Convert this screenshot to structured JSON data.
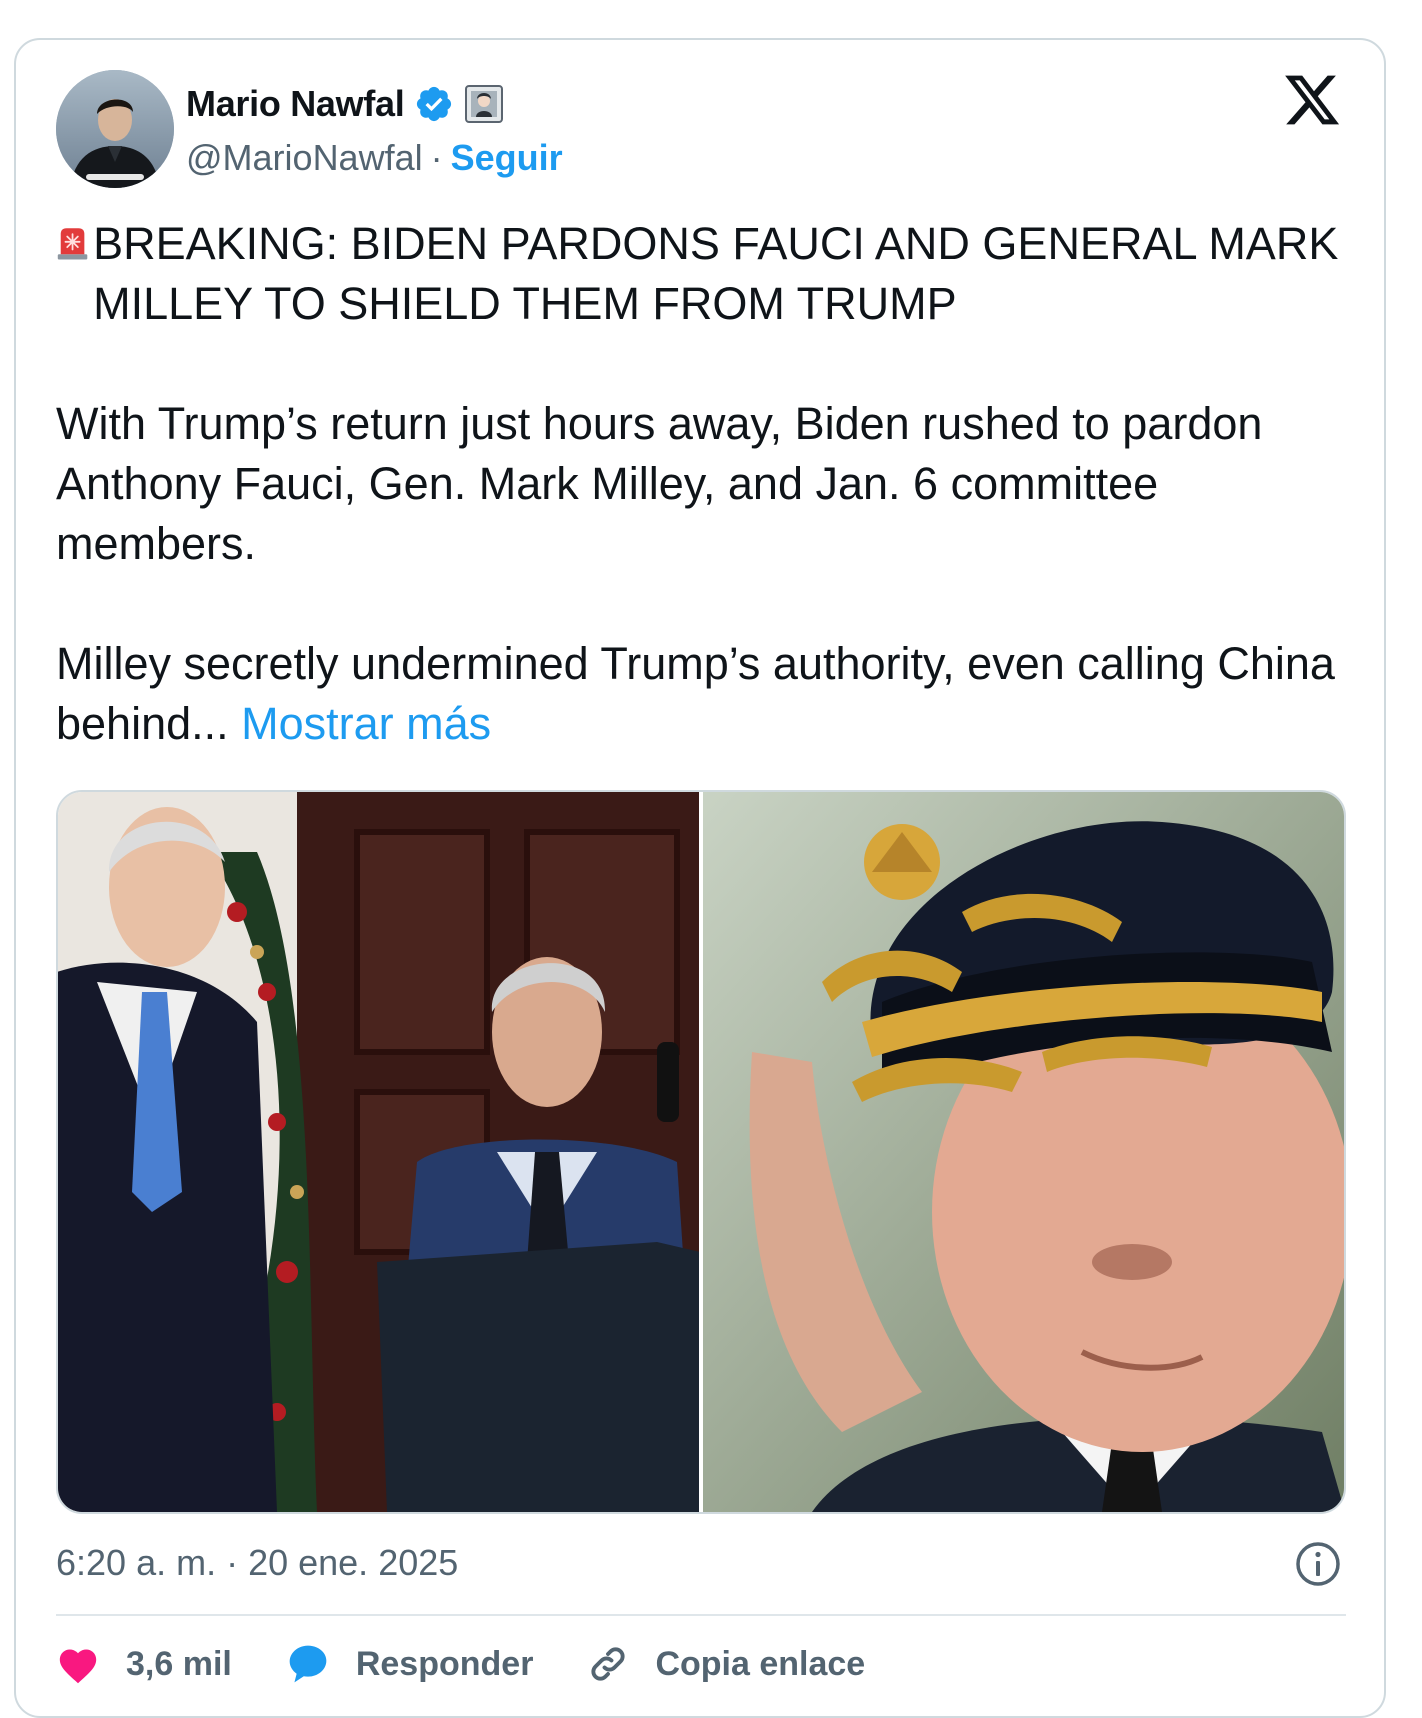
{
  "author": {
    "name": "Mario Nawfal",
    "handle": "@MarioNawfal",
    "separator": "·",
    "follow_label": "Seguir",
    "verified_color": "#1d9bf0"
  },
  "brand": {
    "logo_icon": "x-logo-icon"
  },
  "tweet": {
    "headline": "BREAKING: BIDEN PARDONS FAUCI AND GENERAL MARK MILLEY TO SHIELD THEM FROM TRUMP",
    "paragraph1": "With Trump’s return just hours away, Biden rushed to pardon Anthony Fauci, Gen. Mark Milley, and Jan. 6 committee members.",
    "paragraph2": "Milley secretly undermined Trump’s authority, even calling China behind...",
    "show_more": "Mostrar más",
    "headline_emoji": "siren-emoji-icon"
  },
  "timestamp": "6:20 a. m. · 20 ene. 2025",
  "actions": {
    "likes": "3,6 mil",
    "reply": "Responder",
    "copy_link": "Copia enlace"
  },
  "colors": {
    "link": "#1d9bf0",
    "like": "#f91880",
    "reply": "#1d9bf0",
    "muted": "#536471"
  }
}
